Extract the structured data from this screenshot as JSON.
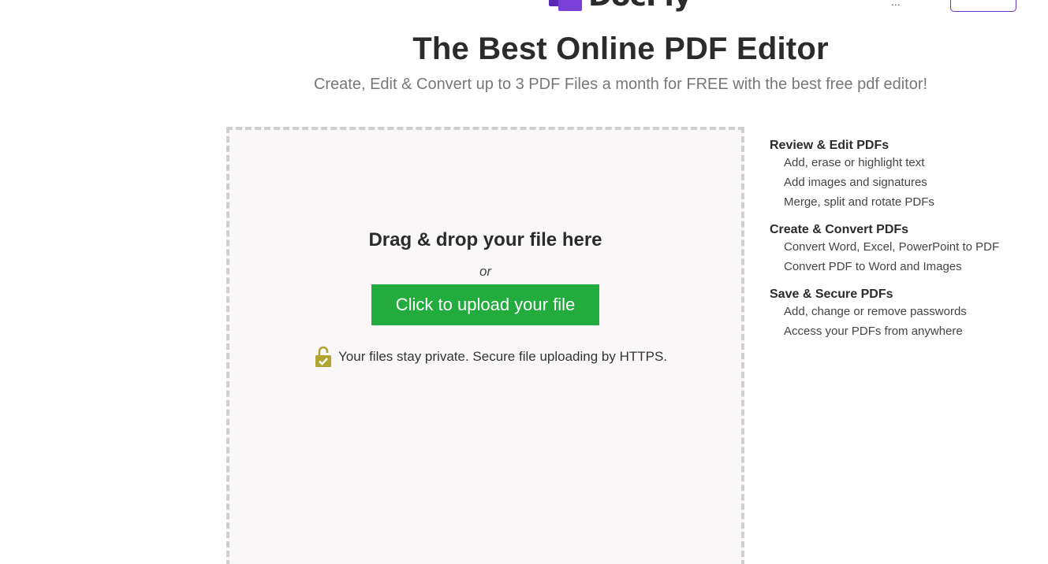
{
  "header": {
    "logo_text": "DocFly",
    "menu_hint": "...",
    "account_button_label": ""
  },
  "hero": {
    "title": "The Best Online PDF Editor",
    "subtitle": "Create, Edit & Convert up to 3 PDF Files a month for FREE with the best free pdf editor!"
  },
  "upload": {
    "drop_title": "Drag & drop your file here",
    "or_text": "or",
    "button_label": "Click to upload your file",
    "secure_text": "Your files stay private. Secure file uploading by HTTPS.",
    "icon": "lock-icon"
  },
  "features": [
    {
      "heading": "Review & Edit PDFs",
      "items": [
        "Add, erase or highlight text",
        "Add images and signatures",
        "Merge, split and rotate PDFs"
      ]
    },
    {
      "heading": "Create & Convert PDFs",
      "items": [
        "Convert Word, Excel, PowerPoint to PDF",
        "Convert PDF to Word and Images"
      ]
    },
    {
      "heading": "Save & Secure PDFs",
      "items": [
        "Add, change or remove passwords",
        "Access your PDFs from anywhere"
      ]
    }
  ],
  "colors": {
    "brand_purple": "#6a2fc4",
    "upload_green": "#22ac3e",
    "lock_olive": "#b0a530"
  }
}
